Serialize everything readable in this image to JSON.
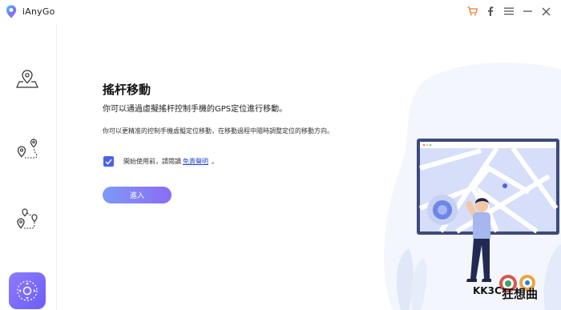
{
  "app": {
    "name": "iAnyGo"
  },
  "window_controls": {
    "cart_icon": "cart-icon",
    "facebook_icon": "facebook-icon",
    "menu_icon": "menu-icon",
    "minimize_icon": "minimize-icon",
    "close_icon": "close-icon",
    "accent_color": "#f07a2c"
  },
  "sidebar": {
    "items": [
      {
        "icon": "single-spot-pin-icon"
      },
      {
        "icon": "two-spot-route-icon"
      },
      {
        "icon": "multi-spot-route-icon"
      },
      {
        "icon": "joystick-icon",
        "active": true
      }
    ]
  },
  "main": {
    "title": "搖杆移動",
    "subtitle": "你可以通過虛擬搖杆控制手機的GPS定位進行移動。",
    "description": "你可以更精准的控制手機虛擬定位移動，在移動過程中隨時調整定位的移動方向。",
    "agree_prefix": "開始使用前，請閱讀",
    "agree_link": "免責聲明",
    "agree_suffix": "。",
    "agree_checked": true,
    "enter_label": "進入"
  },
  "watermark": {
    "brand": "KK3C",
    "cn": "狂想曲"
  },
  "colors": {
    "primary": "#6d5ef5",
    "link": "#2a46d6",
    "checkbox": "#4a63e8"
  }
}
